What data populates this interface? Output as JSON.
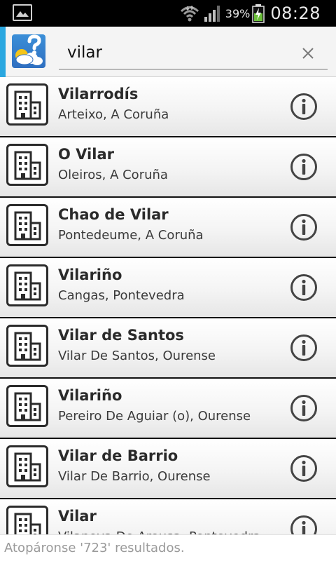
{
  "status_bar": {
    "battery_percent": "39%",
    "time": "08:28",
    "icons": [
      "gallery-icon",
      "wifi-icon",
      "signal-icon",
      "battery-charging-icon"
    ]
  },
  "search": {
    "value": "vilar",
    "icons": [
      "app-weather-question-icon",
      "close-icon"
    ]
  },
  "results": [
    {
      "name": "Vilarrodís",
      "location": "Arteixo, A Coruña"
    },
    {
      "name": "O Vilar",
      "location": "Oleiros, A Coruña"
    },
    {
      "name": "Chao de Vilar",
      "location": "Pontedeume, A Coruña"
    },
    {
      "name": "Vilariño",
      "location": "Cangas, Pontevedra"
    },
    {
      "name": "Vilar de Santos",
      "location": "Vilar De Santos, Ourense"
    },
    {
      "name": "Vilariño",
      "location": "Pereiro De Aguiar (o), Ourense"
    },
    {
      "name": "Vilar de Barrio",
      "location": "Vilar De Barrio, Ourense"
    },
    {
      "name": "Vilar",
      "location": "Vilanova De Arousa, Pontevedra"
    }
  ],
  "row_icons": [
    "building-icon",
    "info-icon"
  ],
  "footer": {
    "results_text": "Atopáronse '723' resultados."
  },
  "colors": {
    "accent": "#2aa7e0",
    "status_bar": "#000000"
  }
}
